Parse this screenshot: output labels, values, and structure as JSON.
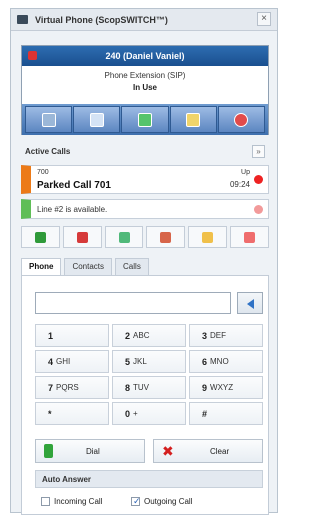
{
  "window": {
    "title": "Virtual Phone (ScopSWITCH™)",
    "close_label": "×"
  },
  "extension": {
    "name": "240 (Daniel Vaniel)",
    "sub": "Phone Extension (SIP)",
    "status": "In Use",
    "toolbar": [
      "user-icon",
      "transfer-icon",
      "park-icon",
      "unknown-icon",
      "hangup-icon"
    ]
  },
  "active_calls": {
    "title": "Active Calls",
    "mini_label": "»",
    "calls": [
      {
        "meta": "700",
        "name": "Parked Call 701",
        "state": "Up",
        "time": "09:24"
      },
      {
        "line": "Line #2 is available."
      }
    ]
  },
  "actions": [
    "answer-icon",
    "hangup-icon",
    "park-icon",
    "record-icon",
    "send-icon",
    "stop-icon"
  ],
  "tabs": [
    "Phone",
    "Contacts",
    "Calls"
  ],
  "dial": {
    "input_value": "",
    "back_label": "",
    "keys": [
      {
        "digit": "1",
        "letters": ""
      },
      {
        "digit": "2",
        "letters": "ABC"
      },
      {
        "digit": "3",
        "letters": "DEF"
      },
      {
        "digit": "4",
        "letters": "GHI"
      },
      {
        "digit": "5",
        "letters": "JKL"
      },
      {
        "digit": "6",
        "letters": "MNO"
      },
      {
        "digit": "7",
        "letters": "PQRS"
      },
      {
        "digit": "8",
        "letters": "TUV"
      },
      {
        "digit": "9",
        "letters": "WXYZ"
      },
      {
        "digit": "*",
        "letters": ""
      },
      {
        "digit": "0",
        "letters": "+"
      },
      {
        "digit": "#",
        "letters": ""
      }
    ],
    "dial_label": "Dial",
    "clear_label": "Clear"
  },
  "auto_answer": {
    "title": "Auto Answer",
    "incoming_label": "Incoming Call",
    "outgoing_label": "Outgoing Call",
    "incoming_checked": false,
    "outgoing_checked": true
  }
}
